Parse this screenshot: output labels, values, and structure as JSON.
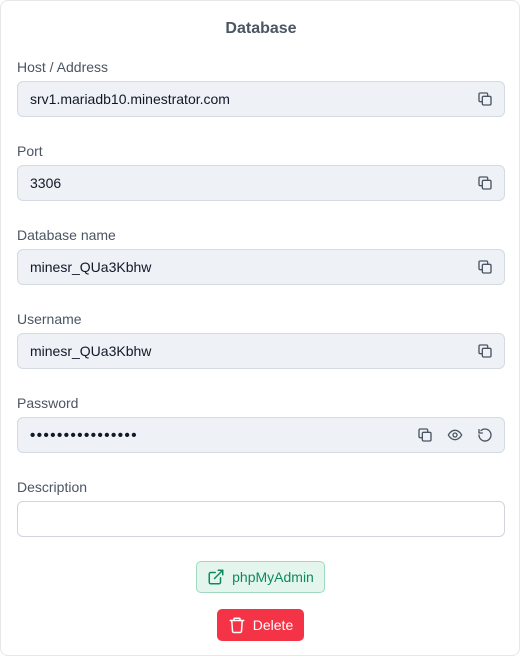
{
  "title": "Database",
  "fields": {
    "host": {
      "label": "Host / Address",
      "value": "srv1.mariadb10.minestrator.com"
    },
    "port": {
      "label": "Port",
      "value": "3306"
    },
    "dbname": {
      "label": "Database name",
      "value": "minesr_QUa3Kbhw"
    },
    "username": {
      "label": "Username",
      "value": "minesr_QUa3Kbhw"
    },
    "password": {
      "label": "Password",
      "value": "••••••••••••••••"
    },
    "description": {
      "label": "Description",
      "value": ""
    }
  },
  "icons": {
    "copy": "copy-icon",
    "eye": "eye-icon",
    "regenerate": "refresh-icon",
    "external": "external-link-icon",
    "trash": "trash-icon"
  },
  "buttons": {
    "phpmyadmin": "phpMyAdmin",
    "delete": "Delete"
  },
  "colors": {
    "field_bg": "#eef1f6",
    "pma_bg": "#e4f5ee",
    "pma_text": "#0f8a5f",
    "delete_bg": "#f43347"
  }
}
